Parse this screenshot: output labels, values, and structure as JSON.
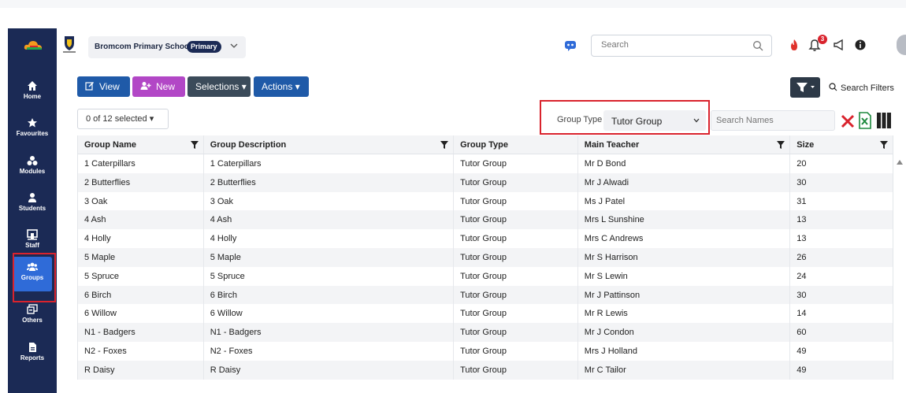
{
  "sidebar": {
    "items": [
      {
        "label": "Home",
        "icon": "home-icon"
      },
      {
        "label": "Favourites",
        "icon": "star-icon"
      },
      {
        "label": "Modules",
        "icon": "modules-icon"
      },
      {
        "label": "Students",
        "icon": "person-icon"
      },
      {
        "label": "Staff",
        "icon": "staff-board-icon"
      },
      {
        "label": "Groups",
        "icon": "groups-icon",
        "active": true
      },
      {
        "label": "Others",
        "icon": "others-icon"
      },
      {
        "label": "Reports",
        "icon": "report-icon"
      }
    ]
  },
  "header": {
    "school_name": "Bromcom Primary School",
    "school_badge": "Primary",
    "search_placeholder": "Search",
    "notification_count": "3"
  },
  "toolbar": {
    "view_label": "View",
    "new_label": "New",
    "selections_label": "Selections ▾",
    "actions_label": "Actions ▾",
    "search_filters_label": "Search Filters",
    "selected_count": "0 of 12  selected ▾"
  },
  "filter": {
    "group_type_label": "Group Type",
    "group_type_value": "Tutor Group",
    "names_placeholder": "Search Names"
  },
  "table": {
    "columns": [
      "Group Name",
      "Group Description",
      "Group Type",
      "Main Teacher",
      "Size"
    ],
    "rows": [
      [
        "1 Caterpillars",
        "1 Caterpillars",
        "Tutor Group",
        "Mr D Bond",
        "20"
      ],
      [
        "2 Butterflies",
        "2 Butterflies",
        "Tutor Group",
        "Mr J Alwadi",
        "30"
      ],
      [
        "3 Oak",
        "3 Oak",
        "Tutor Group",
        "Ms J Patel",
        "31"
      ],
      [
        "4 Ash",
        "4 Ash",
        "Tutor Group",
        "Mrs L Sunshine",
        "13"
      ],
      [
        "4 Holly",
        "4 Holly",
        "Tutor Group",
        "Mrs C Andrews",
        "13"
      ],
      [
        "5 Maple",
        "5 Maple",
        "Tutor Group",
        "Mr S Harrison",
        "26"
      ],
      [
        "5 Spruce",
        "5 Spruce",
        "Tutor Group",
        "Mr S Lewin",
        "24"
      ],
      [
        "6 Birch",
        "6 Birch",
        "Tutor Group",
        "Mr J Pattinson",
        "30"
      ],
      [
        "6 Willow",
        "6 Willow",
        "Tutor Group",
        "Mr R Lewis",
        "14"
      ],
      [
        "N1 - Badgers",
        "N1 - Badgers",
        "Tutor Group",
        "Mr J Condon",
        "60"
      ],
      [
        "N2 - Foxes",
        "N2 - Foxes",
        "Tutor Group",
        "Mrs J Holland",
        "49"
      ],
      [
        "R Daisy",
        "R Daisy",
        "Tutor Group",
        "Mr C Tailor",
        "49"
      ]
    ]
  },
  "colors": {
    "sidebar_bg": "#1b2a55",
    "active_nav": "#2f6bd8",
    "primary_btn": "#1f5aa8",
    "new_btn": "#b247c6",
    "highlight": "#d9232d"
  }
}
